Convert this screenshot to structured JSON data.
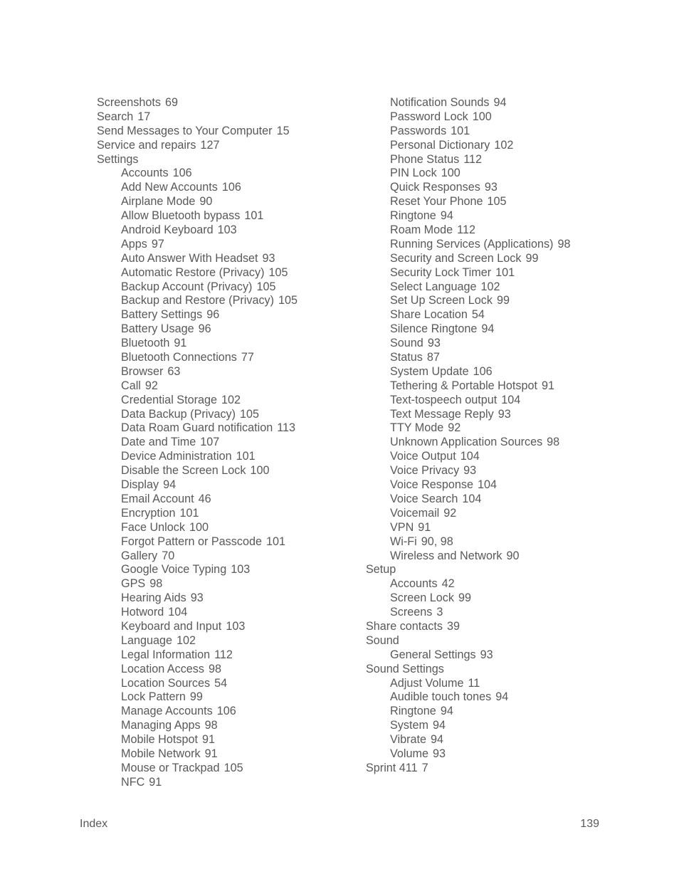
{
  "left_column": [
    {
      "term": "Screenshots",
      "pages": "69",
      "level": 0
    },
    {
      "term": "Search",
      "pages": "17",
      "level": 0
    },
    {
      "term": "Send Messages to Your Computer",
      "pages": "15",
      "level": 0
    },
    {
      "term": "Service and repairs",
      "pages": "127",
      "level": 0
    },
    {
      "term": "Settings",
      "pages": "",
      "level": 0
    },
    {
      "term": "Accounts",
      "pages": "106",
      "level": 1
    },
    {
      "term": "Add New Accounts",
      "pages": "106",
      "level": 1
    },
    {
      "term": "Airplane Mode",
      "pages": "90",
      "level": 1
    },
    {
      "term": "Allow Bluetooth bypass",
      "pages": "101",
      "level": 1
    },
    {
      "term": "Android Keyboard",
      "pages": "103",
      "level": 1
    },
    {
      "term": "Apps",
      "pages": "97",
      "level": 1
    },
    {
      "term": "Auto Answer With Headset",
      "pages": "93",
      "level": 1
    },
    {
      "term": "Automatic Restore (Privacy)",
      "pages": "105",
      "level": 1
    },
    {
      "term": "Backup Account (Privacy)",
      "pages": "105",
      "level": 1
    },
    {
      "term": "Backup and Restore (Privacy)",
      "pages": "105",
      "level": 1
    },
    {
      "term": "Battery Settings",
      "pages": "96",
      "level": 1
    },
    {
      "term": "Battery Usage",
      "pages": "96",
      "level": 1
    },
    {
      "term": "Bluetooth",
      "pages": "91",
      "level": 1
    },
    {
      "term": "Bluetooth Connections",
      "pages": "77",
      "level": 1
    },
    {
      "term": "Browser",
      "pages": "63",
      "level": 1
    },
    {
      "term": "Call",
      "pages": "92",
      "level": 1
    },
    {
      "term": "Credential Storage",
      "pages": "102",
      "level": 1
    },
    {
      "term": "Data Backup (Privacy)",
      "pages": "105",
      "level": 1
    },
    {
      "term": "Data Roam Guard notification",
      "pages": "113",
      "level": 1
    },
    {
      "term": "Date and Time",
      "pages": "107",
      "level": 1
    },
    {
      "term": "Device Administration",
      "pages": "101",
      "level": 1
    },
    {
      "term": "Disable the Screen Lock",
      "pages": "100",
      "level": 1
    },
    {
      "term": "Display",
      "pages": "94",
      "level": 1
    },
    {
      "term": "Email Account",
      "pages": "46",
      "level": 1
    },
    {
      "term": "Encryption",
      "pages": "101",
      "level": 1
    },
    {
      "term": "Face Unlock",
      "pages": "100",
      "level": 1
    },
    {
      "term": "Forgot Pattern or Passcode",
      "pages": "101",
      "level": 1
    },
    {
      "term": "Gallery",
      "pages": "70",
      "level": 1
    },
    {
      "term": "Google Voice Typing",
      "pages": "103",
      "level": 1
    },
    {
      "term": "GPS",
      "pages": "98",
      "level": 1
    },
    {
      "term": "Hearing Aids",
      "pages": "93",
      "level": 1
    },
    {
      "term": "Hotword",
      "pages": "104",
      "level": 1
    },
    {
      "term": "Keyboard and Input",
      "pages": "103",
      "level": 1
    },
    {
      "term": "Language",
      "pages": "102",
      "level": 1
    },
    {
      "term": "Legal Information",
      "pages": "112",
      "level": 1
    },
    {
      "term": "Location Access",
      "pages": "98",
      "level": 1
    },
    {
      "term": "Location Sources",
      "pages": "54",
      "level": 1
    },
    {
      "term": "Lock Pattern",
      "pages": "99",
      "level": 1
    },
    {
      "term": "Manage Accounts",
      "pages": "106",
      "level": 1
    },
    {
      "term": "Managing Apps",
      "pages": "98",
      "level": 1
    },
    {
      "term": "Mobile Hotspot",
      "pages": "91",
      "level": 1
    },
    {
      "term": "Mobile Network",
      "pages": "91",
      "level": 1
    },
    {
      "term": "Mouse or Trackpad",
      "pages": "105",
      "level": 1
    },
    {
      "term": "NFC",
      "pages": "91",
      "level": 1
    }
  ],
  "right_column": [
    {
      "term": "Notification Sounds",
      "pages": "94",
      "level": 1
    },
    {
      "term": "Password Lock",
      "pages": "100",
      "level": 1
    },
    {
      "term": "Passwords",
      "pages": "101",
      "level": 1
    },
    {
      "term": "Personal Dictionary",
      "pages": "102",
      "level": 1
    },
    {
      "term": "Phone Status",
      "pages": "112",
      "level": 1
    },
    {
      "term": "PIN Lock",
      "pages": "100",
      "level": 1
    },
    {
      "term": "Quick Responses",
      "pages": "93",
      "level": 1
    },
    {
      "term": "Reset Your Phone",
      "pages": "105",
      "level": 1
    },
    {
      "term": "Ringtone",
      "pages": "94",
      "level": 1
    },
    {
      "term": "Roam Mode",
      "pages": "112",
      "level": 1
    },
    {
      "term": "Running Services (Applications)",
      "pages": "98",
      "level": 1
    },
    {
      "term": "Security and Screen Lock",
      "pages": "99",
      "level": 1
    },
    {
      "term": "Security Lock Timer",
      "pages": "101",
      "level": 1
    },
    {
      "term": "Select Language",
      "pages": "102",
      "level": 1
    },
    {
      "term": "Set Up Screen Lock",
      "pages": "99",
      "level": 1
    },
    {
      "term": "Share Location",
      "pages": "54",
      "level": 1
    },
    {
      "term": "Silence Ringtone",
      "pages": "94",
      "level": 1
    },
    {
      "term": "Sound",
      "pages": "93",
      "level": 1
    },
    {
      "term": "Status",
      "pages": "87",
      "level": 1
    },
    {
      "term": "System Update",
      "pages": "106",
      "level": 1
    },
    {
      "term": "Tethering & Portable Hotspot",
      "pages": "91",
      "level": 1
    },
    {
      "term": "Text-tospeech output",
      "pages": "104",
      "level": 1
    },
    {
      "term": "Text Message Reply",
      "pages": "93",
      "level": 1
    },
    {
      "term": "TTY Mode",
      "pages": "92",
      "level": 1
    },
    {
      "term": "Unknown Application Sources",
      "pages": "98",
      "level": 1
    },
    {
      "term": "Voice Output",
      "pages": "104",
      "level": 1
    },
    {
      "term": "Voice Privacy",
      "pages": "93",
      "level": 1
    },
    {
      "term": "Voice Response",
      "pages": "104",
      "level": 1
    },
    {
      "term": "Voice Search",
      "pages": "104",
      "level": 1
    },
    {
      "term": "Voicemail",
      "pages": "92",
      "level": 1
    },
    {
      "term": "VPN",
      "pages": "91",
      "level": 1
    },
    {
      "term": "Wi-Fi",
      "pages": "90, 98",
      "level": 1
    },
    {
      "term": "Wireless and Network",
      "pages": "90",
      "level": 1
    },
    {
      "term": "Setup",
      "pages": "",
      "level": 0
    },
    {
      "term": "Accounts",
      "pages": "42",
      "level": 1
    },
    {
      "term": "Screen Lock",
      "pages": "99",
      "level": 1
    },
    {
      "term": "Screens",
      "pages": "3",
      "level": 1
    },
    {
      "term": "Share contacts",
      "pages": "39",
      "level": 0
    },
    {
      "term": "Sound",
      "pages": "",
      "level": 0
    },
    {
      "term": "General Settings",
      "pages": "93",
      "level": 1
    },
    {
      "term": "Sound Settings",
      "pages": "",
      "level": 0
    },
    {
      "term": "Adjust Volume",
      "pages": "11",
      "level": 1
    },
    {
      "term": "Audible touch tones",
      "pages": "94",
      "level": 1
    },
    {
      "term": "Ringtone",
      "pages": "94",
      "level": 1
    },
    {
      "term": "System",
      "pages": "94",
      "level": 1
    },
    {
      "term": "Vibrate",
      "pages": "94",
      "level": 1
    },
    {
      "term": "Volume",
      "pages": "93",
      "level": 1
    },
    {
      "term": "Sprint 411",
      "pages": "7",
      "level": 0
    }
  ],
  "footer": {
    "section": "Index",
    "page_number": "139"
  }
}
